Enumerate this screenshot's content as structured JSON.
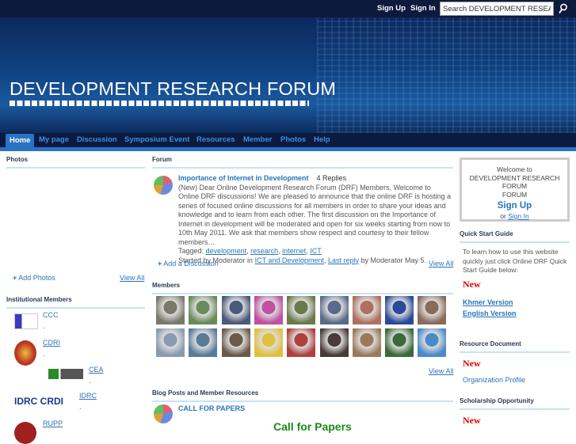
{
  "topbar": {
    "sign_up": "Sign Up",
    "sign_in": "Sign In",
    "search_placeholder": "Search DEVELOPMENT RESEARCH FORUM"
  },
  "header": {
    "title": "DEVELOPMENT RESEARCH FORUM"
  },
  "nav": {
    "items": [
      "Home",
      "My page",
      "Discussion",
      "Symposium Event",
      "Resources",
      "Member",
      "Photos",
      "Help"
    ]
  },
  "photos": {
    "heading": "Photos",
    "add": "Add Photos",
    "view_all": "View All"
  },
  "institutional": {
    "heading": "Institutional Members",
    "items": [
      {
        "name": "CCC",
        "dot": "."
      },
      {
        "name": "CDRI",
        "dot": "."
      },
      {
        "name": "CEA",
        "dot": "."
      },
      {
        "name": "IDRC",
        "dot": "."
      },
      {
        "name": "RUPP"
      }
    ],
    "idrc_logo": "IDRC CRDI"
  },
  "forum": {
    "heading": "Forum",
    "topic": "Importance of Internet in Development",
    "replies": "4 Replies",
    "excerpt": "(New) Dear Online Development Research Forum (DRF) Members,   Welcome to Online DRF discussions! We are pleased to announce that the online DRF is hosting a series of focused online discussions for all members in order to share your ideas and knowledge and to learn from each other.    The first discussion on the Importance of Internet in development will be moderated and open for six weeks starting from now to 10th May 2011. We ask that members show respect and courtesy to their fellow members…",
    "tagged_label": "Tagged:",
    "tags": [
      "development",
      "research",
      "internet",
      "ICT"
    ],
    "started_prefix": "Started by Moderator in",
    "category": "ICT and Development",
    "last_reply": "Last reply",
    "started_suffix": "by Moderator May 5.",
    "add": "Add a Discussion",
    "view_all": "View All"
  },
  "members": {
    "heading": "Members",
    "view_all": "View All",
    "colors": [
      "#7a7a6a",
      "#6b8a5a",
      "#4a5a7a",
      "#c050a0",
      "#6a7a4a",
      "#5a6a8a",
      "#b07060",
      "#2a4a9a",
      "#8a6a5a",
      "#8a9ab0",
      "#5a7a9a",
      "#6a5a4a",
      "#e0c040",
      "#b04040",
      "#4a3a3a",
      "#9a7a5a",
      "#3a6a3a",
      "#4a8aca"
    ]
  },
  "blog": {
    "heading": "Blog Posts and Member Resources",
    "post_title": "CALL FOR PAPERS",
    "post_heading": "Call for Papers"
  },
  "welcome": {
    "line1": "Welcome to",
    "line2": "DEVELOPMENT RESEARCH FORUM",
    "sign_up": "Sign Up",
    "or": "or",
    "sign_in": "Sign In"
  },
  "quick": {
    "heading": "Quick Start Guide",
    "text": "To learn how to use this website quickly just click Online DRF Quick Start Guide below:",
    "new": "New",
    "khmer": "Khmer Version",
    "english": "English Version"
  },
  "resource": {
    "heading": "Resource Document",
    "new": "New",
    "link": "Organization Profile"
  },
  "scholar": {
    "heading": "Scholarship Opportunity",
    "new": "New"
  }
}
